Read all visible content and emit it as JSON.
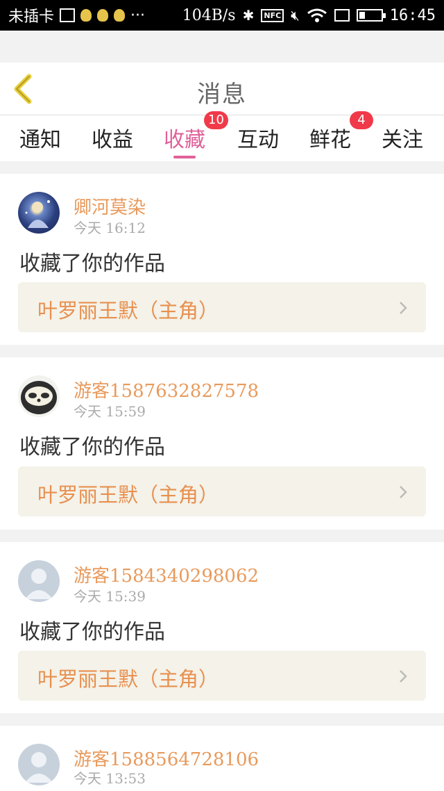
{
  "status_bar": {
    "carrier": "未插卡",
    "more": "···",
    "speed": "104B/s",
    "nfc": "NFC",
    "time": "16:45"
  },
  "header": {
    "title": "消息"
  },
  "tabs": [
    {
      "label": "通知",
      "badge": ""
    },
    {
      "label": "收益",
      "badge": ""
    },
    {
      "label": "收藏",
      "badge": "10",
      "active": true
    },
    {
      "label": "互动",
      "badge": ""
    },
    {
      "label": "鲜花",
      "badge": "4"
    },
    {
      "label": "关注",
      "badge": ""
    }
  ],
  "messages": [
    {
      "user": "卿河莫染",
      "time": "今天 16:12",
      "action": "收藏了你的作品",
      "work": "叶罗丽王默（主角）"
    },
    {
      "user": "游客1587632827578",
      "time": "今天 15:59",
      "action": "收藏了你的作品",
      "work": "叶罗丽王默（主角）"
    },
    {
      "user": "游客1584340298062",
      "time": "今天 15:39",
      "action": "收藏了你的作品",
      "work": "叶罗丽王默（主角）"
    },
    {
      "user": "游客1588564728106",
      "time": "今天 13:53",
      "action": "",
      "work": ""
    }
  ],
  "colors": {
    "accent_pink": "#e0609a",
    "badge_red": "#f03a4a",
    "username_orange": "#e89a5c",
    "back_arrow_yellow": "#e6cf3e"
  }
}
